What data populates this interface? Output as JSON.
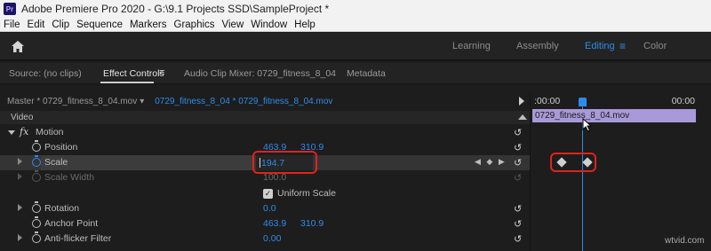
{
  "window": {
    "logo": "Pr",
    "title": "Adobe Premiere Pro 2020 - G:\\9.1 Projects SSD\\SampleProject *"
  },
  "menu": [
    "File",
    "Edit",
    "Clip",
    "Sequence",
    "Markers",
    "Graphics",
    "View",
    "Window",
    "Help"
  ],
  "workspaces": {
    "learning": "Learning",
    "assembly": "Assembly",
    "editing": "Editing",
    "color": "Color"
  },
  "panel_tabs": {
    "source": "Source: (no clips)",
    "effect_controls": "Effect Controls",
    "audio_mixer": "Audio Clip Mixer: 0729_fitness_8_04",
    "metadata": "Metadata"
  },
  "master": {
    "label": "Master * 0729_fitness_8_04.mov",
    "clip": "0729_fitness_8_04 * 0729_fitness_8_04.mov"
  },
  "section": {
    "video": "Video"
  },
  "effects": {
    "motion": "Motion",
    "position": {
      "label": "Position",
      "x": "463.9",
      "y": "310.9"
    },
    "scale": {
      "label": "Scale",
      "value": "194.7"
    },
    "scale_width": {
      "label": "Scale Width",
      "value": "100.0"
    },
    "uniform_scale": "Uniform Scale",
    "rotation": {
      "label": "Rotation",
      "value": "0.0"
    },
    "anchor_point": {
      "label": "Anchor Point",
      "x": "463.9",
      "y": "310.9"
    },
    "anti_flicker": {
      "label": "Anti-flicker Filter",
      "value": "0.00"
    }
  },
  "timeline": {
    "start_tc": ":00:00",
    "end_tc": "00:00",
    "clip_name": "0729_fitness_8_04.mov"
  },
  "watermark": "wtvid.com"
}
